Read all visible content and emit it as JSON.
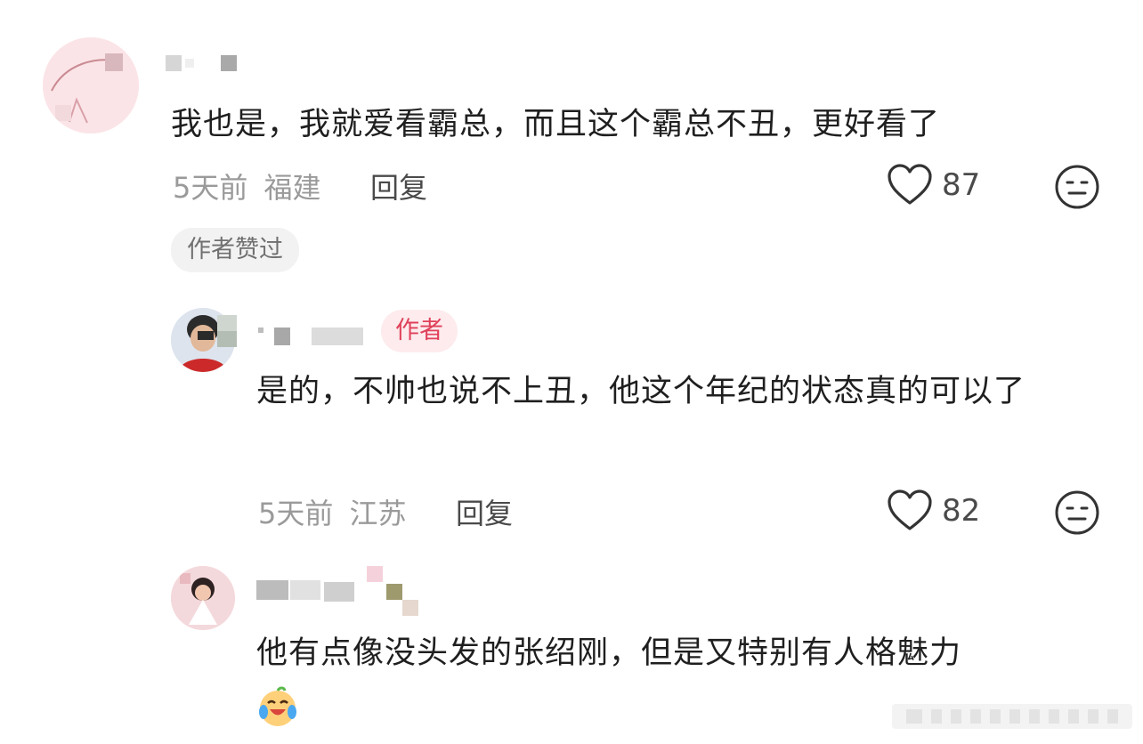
{
  "comments": [
    {
      "text": "我也是，我就爱看霸总，而且这个霸总不丑，更好看了",
      "time": "5天前",
      "location": "福建",
      "reply_label": "回复",
      "likes": "87",
      "liked_by_author_label": "作者赞过"
    },
    {
      "author_tag": "作者",
      "text": "是的，不帅也说不上丑，他这个年纪的状态真的可以了",
      "time": "5天前",
      "location": "江苏",
      "reply_label": "回复",
      "likes": "82"
    },
    {
      "text": "他有点像没头发的张绍刚，但是又特别有人格魅力",
      "emoji": "crying-laughing-emoji"
    }
  ],
  "colors": {
    "author_tag_bg": "#fdebed",
    "author_tag_text": "#e0415a",
    "meta_text": "#9a9a9a"
  }
}
